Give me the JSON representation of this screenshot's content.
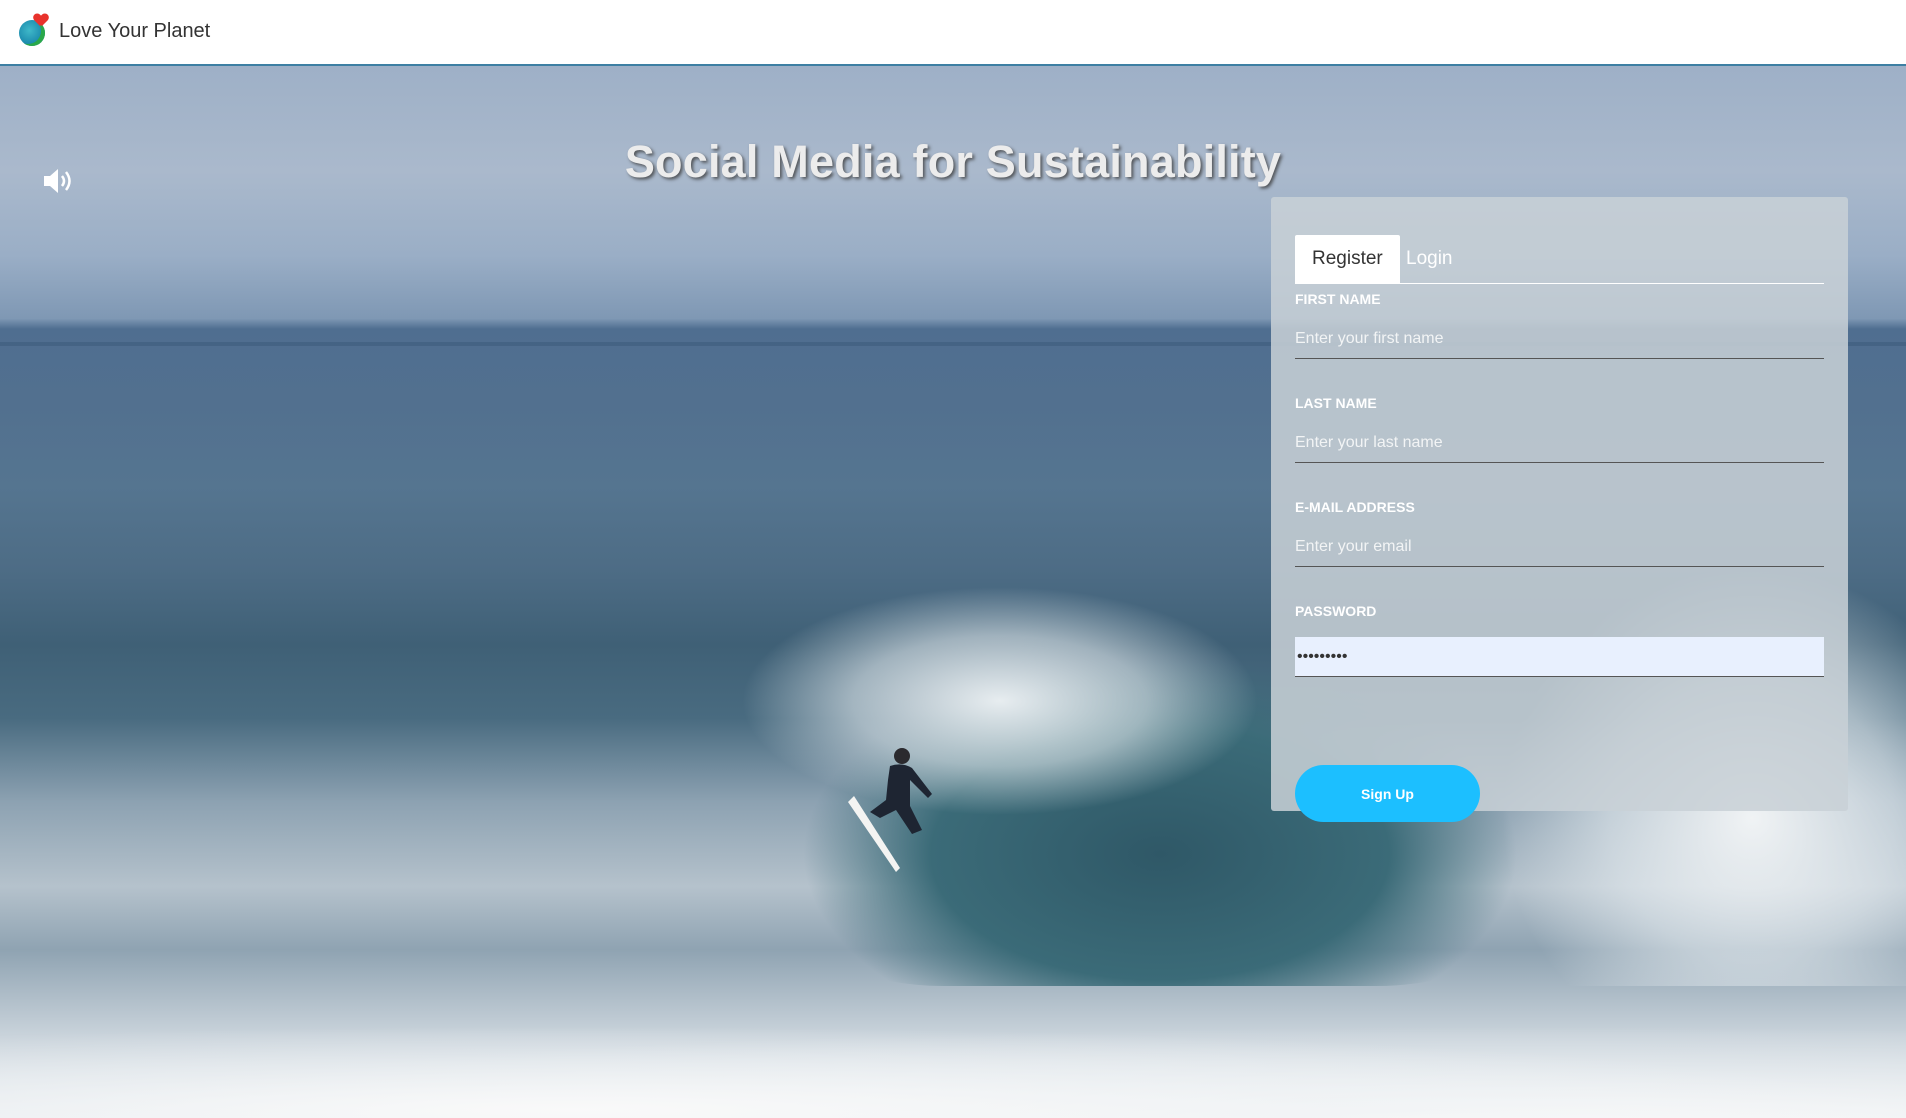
{
  "header": {
    "brand_name": "Love Your Planet",
    "logo_icon": "globe-heart-icon"
  },
  "hero": {
    "headline": "Social Media for Sustainability",
    "sound_icon": "speaker-icon"
  },
  "auth": {
    "tabs": [
      {
        "label": "Register",
        "active": true
      },
      {
        "label": "Login",
        "active": false
      }
    ],
    "fields": {
      "first_name": {
        "label": "FIRST NAME",
        "placeholder": "Enter your first name",
        "value": ""
      },
      "last_name": {
        "label": "LAST NAME",
        "placeholder": "Enter your last name",
        "value": ""
      },
      "email": {
        "label": "E-MAIL ADDRESS",
        "placeholder": "Enter your email",
        "value": ""
      },
      "password": {
        "label": "PASSWORD",
        "value": "•••••••••"
      }
    },
    "submit_label": "Sign Up"
  },
  "colors": {
    "accent": "#1cbfff",
    "header_border": "#3d7fa3",
    "logo_heart": "#e8322c",
    "logo_globe": "#1f8fb0"
  }
}
